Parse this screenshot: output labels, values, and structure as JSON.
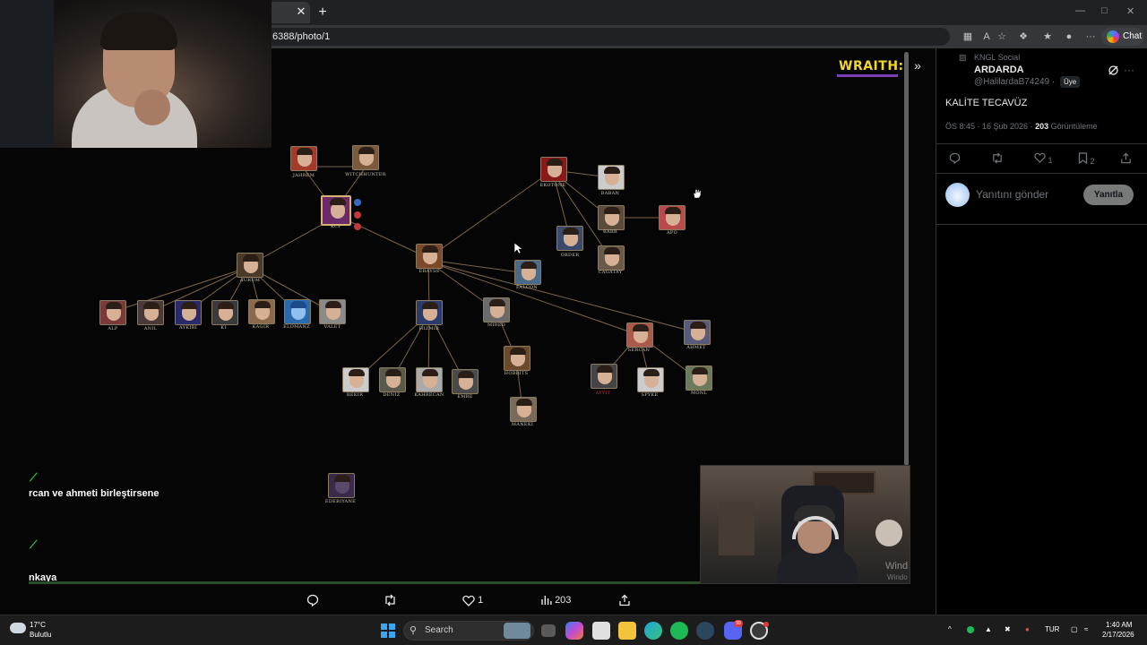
{
  "browser": {
    "url": "6388/photo/1",
    "tab_close": "✕",
    "new_tab": "+",
    "chat_label": "Chat"
  },
  "viewer": {
    "brand_text": "WRAITH:",
    "collapse_icon": "»",
    "graph_nodes": [
      {
        "id": "jahrem",
        "label": "JAHREM",
        "color": "#a33a2a"
      },
      {
        "id": "witchhunter",
        "label": "WITCHHUNTER",
        "color": "#7a5a3a"
      },
      {
        "id": "kcp",
        "label": "KCP",
        "color": "#6a2a6a"
      },
      {
        "id": "ekotone",
        "label": "EKOTONE",
        "color": "#8a1a1a"
      },
      {
        "id": "baban",
        "label": "BABAN",
        "color": "#cccccc"
      },
      {
        "id": "barr",
        "label": "BARR",
        "color": "#5a4a3a"
      },
      {
        "id": "apo",
        "label": "APO",
        "color": "#b84a4a"
      },
      {
        "id": "order",
        "label": "ORDER",
        "color": "#3a4a6a"
      },
      {
        "id": "cagatay",
        "label": "CAGATAY",
        "color": "#6a5a4a"
      },
      {
        "id": "aurum",
        "label": "AURUM",
        "color": "#4a3a2a"
      },
      {
        "id": "erayss",
        "label": "ERAYSS",
        "color": "#7a4a2a"
      },
      {
        "id": "falcon",
        "label": "FALCON",
        "color": "#4a6a8a"
      },
      {
        "id": "alp",
        "label": "ALP",
        "color": "#7a3a3a"
      },
      {
        "id": "anil",
        "label": "ANIL",
        "color": "#4a3a3a"
      },
      {
        "id": "aykirk",
        "label": "AYKIRI",
        "color": "#2a2a6a"
      },
      {
        "id": "k1",
        "label": "K1",
        "color": "#3a3a3a"
      },
      {
        "id": "kagir",
        "label": "KAGIR",
        "color": "#8a6a4a"
      },
      {
        "id": "eloman",
        "label": "ELOMANZ",
        "color": "#2a6aaa"
      },
      {
        "id": "valet",
        "label": "VALET",
        "color": "#8a8a8a"
      },
      {
        "id": "hizmir",
        "label": "HIZMIR",
        "color": "#2a3a6a"
      },
      {
        "id": "mired",
        "label": "MIRED",
        "color": "#6a6a6a"
      },
      {
        "id": "sercan",
        "label": "SERCAN",
        "color": "#aa5a4a"
      },
      {
        "id": "ahmet",
        "label": "AHMET",
        "color": "#5a5a7a"
      },
      {
        "id": "hobbit",
        "label": "HOBBITS",
        "color": "#6a4a2a"
      },
      {
        "id": "bekir",
        "label": "BEKIR",
        "color": "#cccccc"
      },
      {
        "id": "deniz",
        "label": "DENIZ",
        "color": "#5a5a4a"
      },
      {
        "id": "kahrolsun",
        "label": "KAHRECAN",
        "color": "#aaaaaa"
      },
      {
        "id": "emre",
        "label": "EMRE",
        "color": "#4a4a4a"
      },
      {
        "id": "maneki",
        "label": "MANEKI",
        "color": "#7a6a5a"
      },
      {
        "id": "redname",
        "label": "AYYIT",
        "color": "#444444"
      },
      {
        "id": "spyke",
        "label": "SPYKE",
        "color": "#cccccc"
      },
      {
        "id": "monl",
        "label": "MONL",
        "color": "#6a7a5a"
      },
      {
        "id": "edebiyane",
        "label": "EDEBIYANE",
        "color": "#3a2a4a"
      }
    ],
    "chat": [
      {
        "icon": "⟋",
        "text": "rcan ve ahmeti birleştirsene"
      },
      {
        "icon": "⟋",
        "text": "nkaya"
      }
    ],
    "watermark": "Wind",
    "watermark_sub": "Windo",
    "actions": {
      "likes": "1",
      "views": "203"
    }
  },
  "tweet": {
    "community": "KNGL Social",
    "author": "ARDARDA",
    "handle": "@HalilardaB74249 ·",
    "badge": "Üye",
    "text": "KALİTE TECAVÜZ",
    "time": "ÖS 8:45 · 16 Şub 2026 · ",
    "views_count": "203",
    "views_label": " Görüntüleme",
    "likes": "1",
    "bookmarks": "2",
    "reply_placeholder": "Yanıtını gönder",
    "reply_button": "Yanıtla"
  },
  "taskbar": {
    "temp": "17°C",
    "condition": "Bulutlu",
    "search": "Search",
    "lang": "TUR",
    "time": "1:40 AM",
    "date": "2/17/2026",
    "notification_count": "99"
  }
}
